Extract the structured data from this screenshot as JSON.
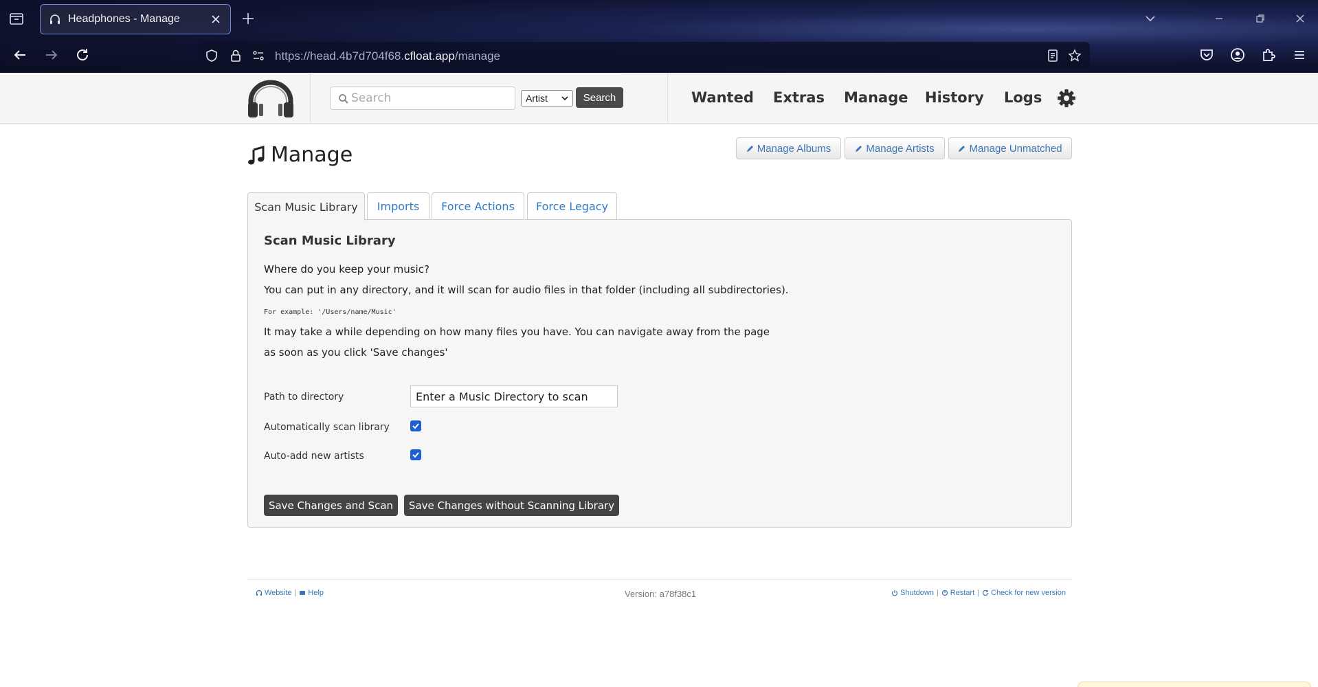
{
  "browser": {
    "tab_title": "Headphones - Manage",
    "url_prefix": "https://head.4b7d704f68.",
    "url_domain": "cfloat.app",
    "url_path": "/manage"
  },
  "header": {
    "search_placeholder": "Search",
    "search_type": "Artist",
    "search_button": "Search",
    "nav": [
      "Wanted",
      "Extras",
      "Manage",
      "History",
      "Logs"
    ]
  },
  "page": {
    "title": "Manage",
    "actions": [
      "Manage Albums",
      "Manage Artists",
      "Manage Unmatched"
    ]
  },
  "tabs": [
    "Scan Music Library",
    "Imports",
    "Force Actions",
    "Force Legacy"
  ],
  "scan": {
    "heading": "Scan Music Library",
    "line1": "Where do you keep your music?",
    "line2": "You can put in any directory, and it will scan for audio files in that folder (including all subdirectories).",
    "example": "For example: '/Users/name/Music'",
    "line3": "It may take a while depending on how many files you have. You can navigate away from the page",
    "line4": "as soon as you click 'Save changes'",
    "path_label": "Path to directory",
    "path_value": "Enter a Music Directory to scan",
    "auto_scan_label": "Automatically scan library",
    "auto_scan_checked": true,
    "auto_add_label": "Auto-add new artists",
    "auto_add_checked": true,
    "btn_scan": "Save Changes and Scan",
    "btn_noscan": "Save Changes without Scanning Library"
  },
  "footer": {
    "website": "Website",
    "help": "Help",
    "version": "Version: a78f38c1",
    "shutdown": "Shutdown",
    "restart": "Restart",
    "check": "Check for new version",
    "sep": "|"
  }
}
